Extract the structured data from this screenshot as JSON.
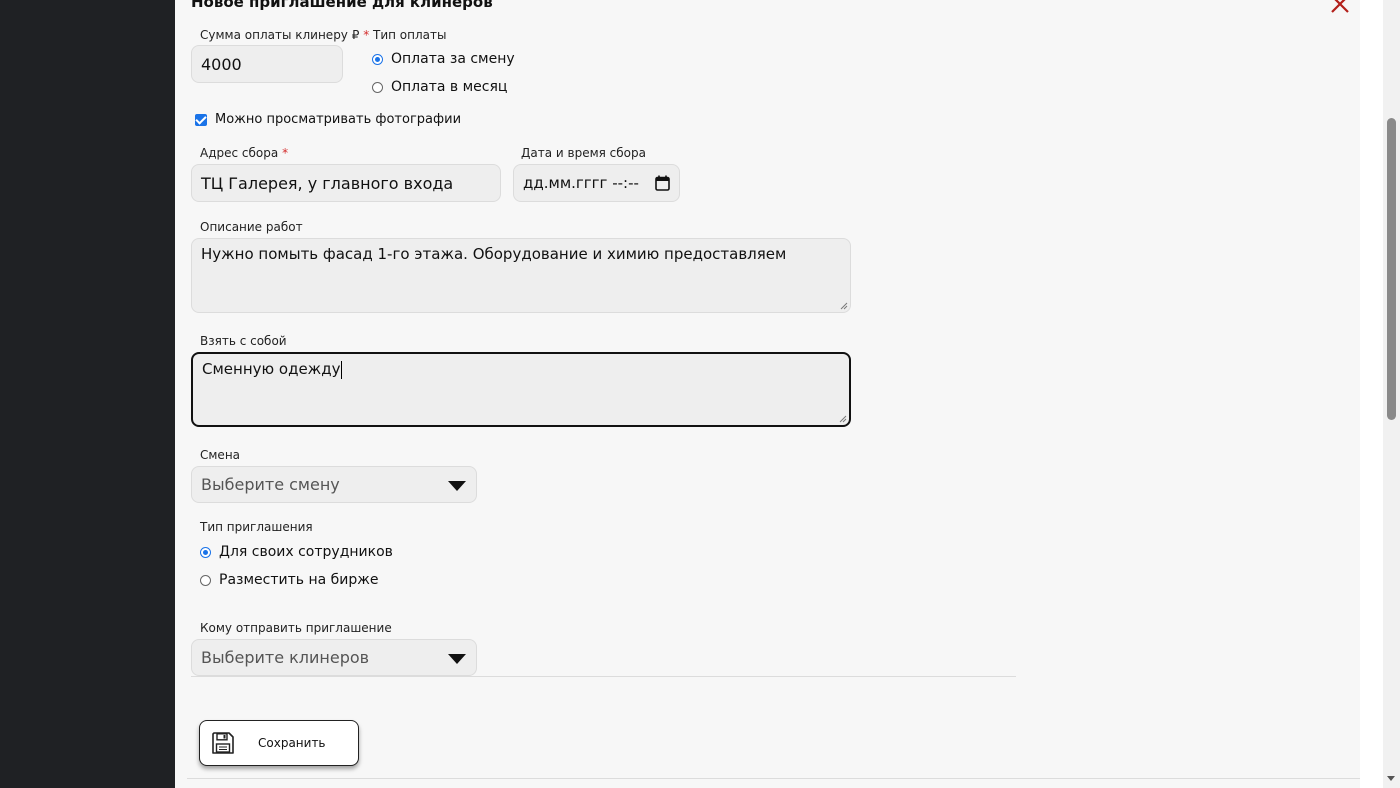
{
  "dialog": {
    "title": "Новое приглашение для клинеров"
  },
  "payment": {
    "amount_label": "Сумма оплаты клинеру ₽",
    "required_mark": "*",
    "amount_value": "4000",
    "type_label": "Тип оплаты",
    "type_options": [
      {
        "label": "Оплата за смену",
        "checked": true
      },
      {
        "label": "Оплата в месяц",
        "checked": false
      }
    ]
  },
  "photos": {
    "label": "Можно просматривать фотографии",
    "checked": true
  },
  "address": {
    "label": "Адрес сбора",
    "required_mark": "*",
    "value": "ТЦ Галерея, у главного входа"
  },
  "datetime": {
    "label": "Дата и время сбора",
    "value": "дд.мм.гггг --:--"
  },
  "description": {
    "label": "Описание работ",
    "value": "Нужно помыть фасад 1-го этажа. Оборудование и химию предоставляем"
  },
  "bring": {
    "label": "Взять с собой",
    "value": "Сменную одежду"
  },
  "shift": {
    "label": "Смена",
    "placeholder": "Выберите смену"
  },
  "invite_type": {
    "label": "Тип приглашения",
    "options": [
      {
        "label": "Для своих сотрудников",
        "checked": true
      },
      {
        "label": "Разместить на бирже",
        "checked": false
      }
    ]
  },
  "recipients": {
    "label": "Кому отправить приглашение",
    "placeholder": "Выберите клинеров"
  },
  "save_button": {
    "label": "Сохранить"
  },
  "colors": {
    "accent": "#1a73e8",
    "close": "#b3201b",
    "required": "#d42c2c",
    "sidebar": "#1f2124"
  },
  "icons": {
    "close": "close-icon",
    "save": "floppy-disk-icon",
    "calendar": "calendar-icon",
    "dropdown": "chevron-down-icon"
  }
}
